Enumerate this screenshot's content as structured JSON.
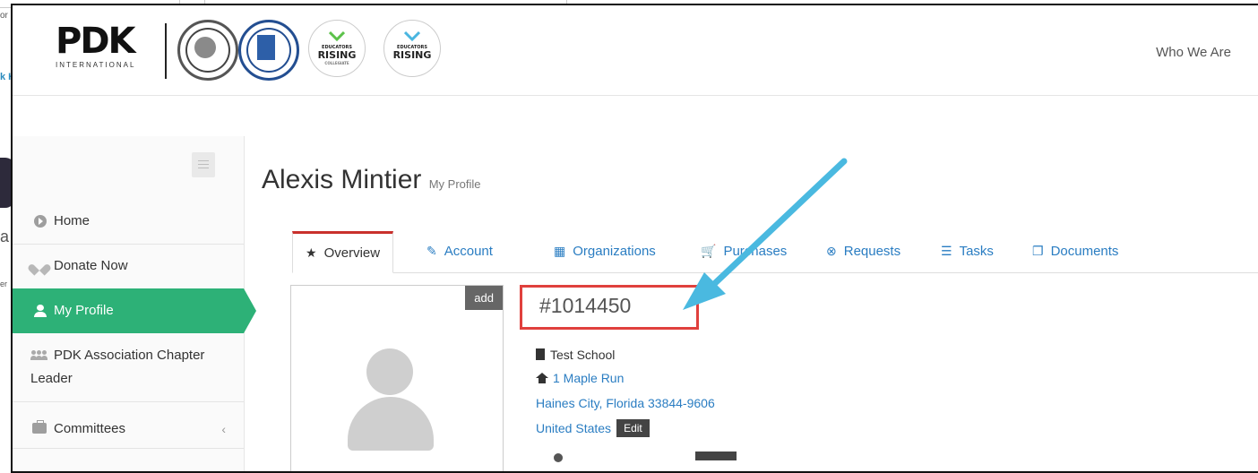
{
  "background": {
    "fragments": [
      "or",
      "k H",
      "a",
      "er"
    ]
  },
  "header": {
    "logo_text": "PDK",
    "logo_subtext": "INTERNATIONAL",
    "partner_logos": [
      {
        "name": "phi-delta-kappa-seal"
      },
      {
        "name": "pi-lambda-theta-seal"
      },
      {
        "name": "educators-rising-collegiate-logo",
        "small": "EDUCATORS",
        "big": "RISING",
        "sub": "COLLEGIATE"
      },
      {
        "name": "educators-rising-logo",
        "small": "EDUCATORS",
        "big": "RISING"
      }
    ],
    "nav_right": "Who We Are"
  },
  "sidebar": {
    "items": [
      {
        "label": "Home",
        "icon": "play-circle-icon",
        "active": false
      },
      {
        "label": "Donate Now",
        "icon": "heart-icon",
        "active": false
      },
      {
        "label": "My Profile",
        "icon": "user-icon",
        "active": true
      },
      {
        "label": "PDK Association Chapter Leader",
        "icon": "group-icon",
        "active": false
      },
      {
        "label": "Committees",
        "icon": "briefcase-icon",
        "active": false
      }
    ],
    "toggle_icon": "menu-toggle-icon",
    "active_color": "#2db177"
  },
  "page": {
    "title": "Alexis Mintier",
    "subtitle": "My Profile"
  },
  "tabs": [
    {
      "label": "Overview",
      "icon": "★",
      "active": true
    },
    {
      "label": "Account",
      "icon": "✎",
      "active": false
    },
    {
      "label": "Organizations",
      "icon": "▦",
      "active": false
    },
    {
      "label": "Purchases",
      "icon": "🛒",
      "active": false
    },
    {
      "label": "Requests",
      "icon": "⊗",
      "active": false
    },
    {
      "label": "Tasks",
      "icon": "☰",
      "active": false
    },
    {
      "label": "Documents",
      "icon": "❐",
      "active": false
    }
  ],
  "profile": {
    "add_label": "add",
    "member_id": "#1014450",
    "school": "Test School",
    "address_line1": "1 Maple Run",
    "address_line2": "Haines City, Florida 33844-9606",
    "country": "United States",
    "edit_label": "Edit"
  },
  "colors": {
    "highlight": "#e0403d",
    "arrow": "#4ab9e0",
    "link": "#2a7dc2",
    "tab_active_top": "#c9302c"
  }
}
